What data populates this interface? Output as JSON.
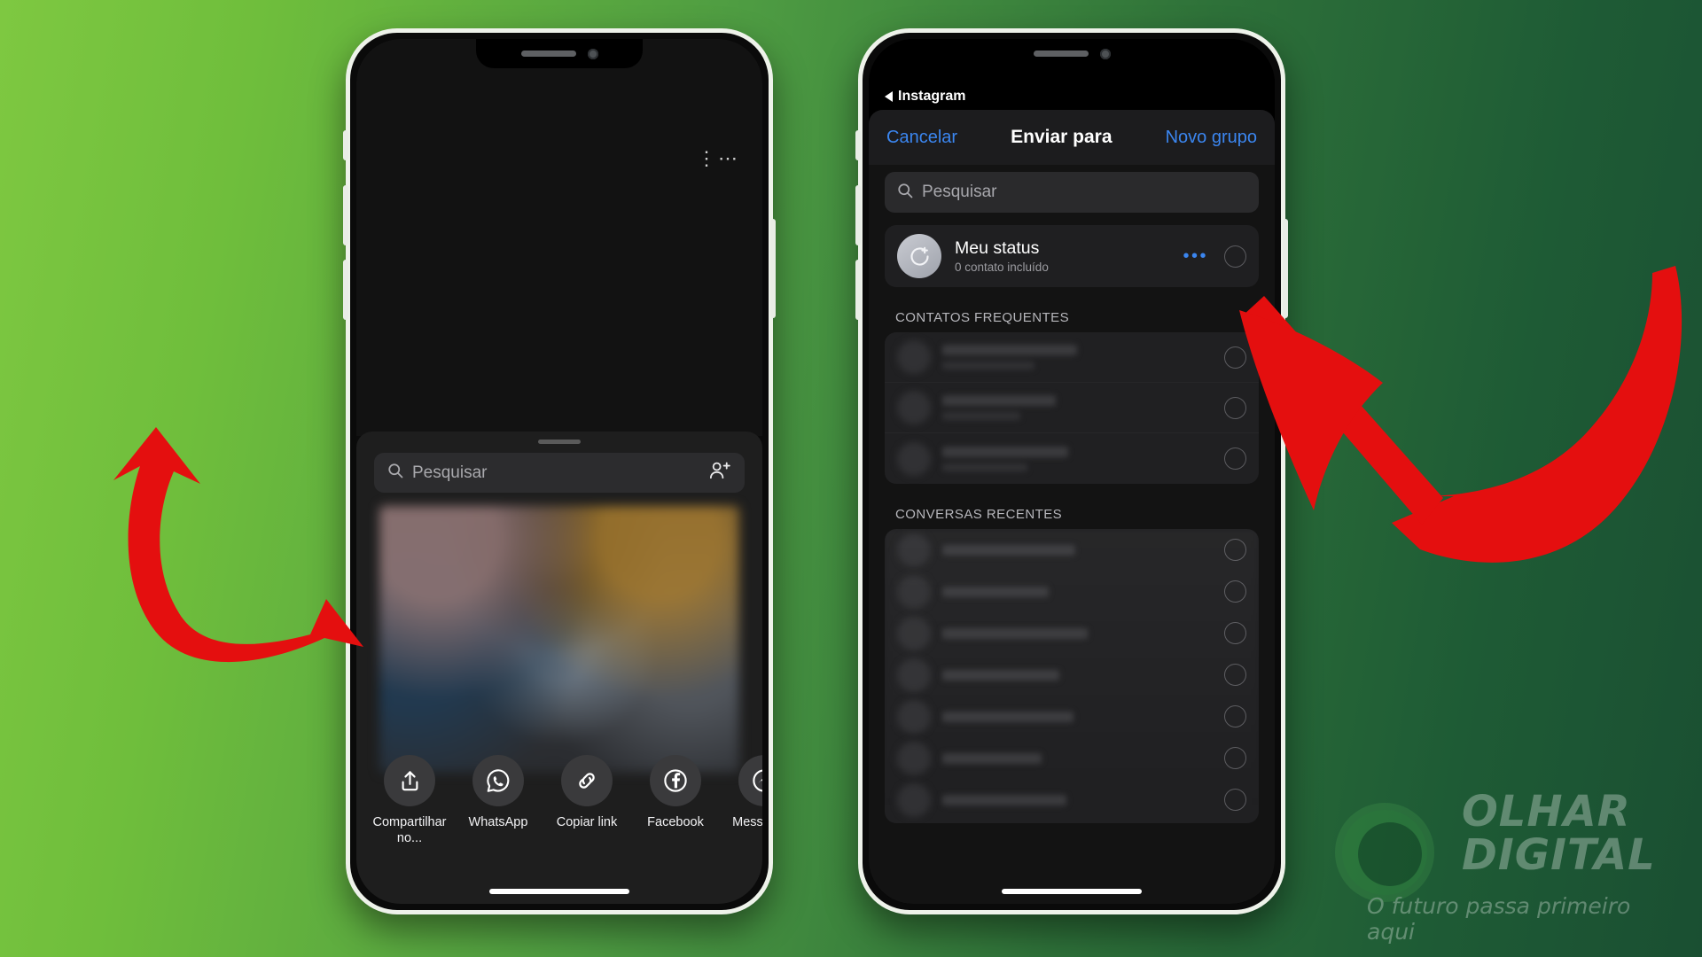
{
  "background": {
    "gradient_from": "#7EC841",
    "gradient_to": "#1A4F32"
  },
  "left_phone": {
    "name": "instagram-share-sheet",
    "overflow_menu": "⋮⋯",
    "search": {
      "placeholder": "Pesquisar",
      "icon": "search-icon",
      "trailing_icon": "add-person-icon"
    },
    "share_targets": [
      {
        "label": "Compartilhar no...",
        "icon": "share-generic-icon"
      },
      {
        "label": "WhatsApp",
        "icon": "whatsapp-icon"
      },
      {
        "label": "Copiar link",
        "icon": "link-icon"
      },
      {
        "label": "Facebook",
        "icon": "facebook-icon"
      },
      {
        "label": "Messenger",
        "icon": "messenger-icon"
      }
    ]
  },
  "right_phone": {
    "name": "whatsapp-send-to",
    "status_back_label": "Instagram",
    "nav": {
      "cancel_label": "Cancelar",
      "title": "Enviar para",
      "new_group_label": "Novo grupo",
      "link_color": "#3b86f0"
    },
    "search": {
      "placeholder": "Pesquisar",
      "icon": "search-icon"
    },
    "my_status": {
      "title": "Meu status",
      "subtitle": "0 contato incluído",
      "more_icon": "more-options-icon",
      "avatar_icon": "status-ring-icon"
    },
    "sections": [
      {
        "header": "CONTATOS FREQUENTES",
        "row_count": 3
      },
      {
        "header": "CONVERSAS RECENTES",
        "row_count": 7
      }
    ]
  },
  "annotations": {
    "arrow_color": "#e40f0f",
    "arrow_left_name": "arrow-pointing-to-whatsapp",
    "arrow_right_name": "arrow-pointing-to-contact-selector"
  },
  "watermark": {
    "line1": "OLHAR",
    "line2": "DIGITAL",
    "tagline": "O futuro passa primeiro aqui",
    "icon": "eye-logo-icon"
  }
}
